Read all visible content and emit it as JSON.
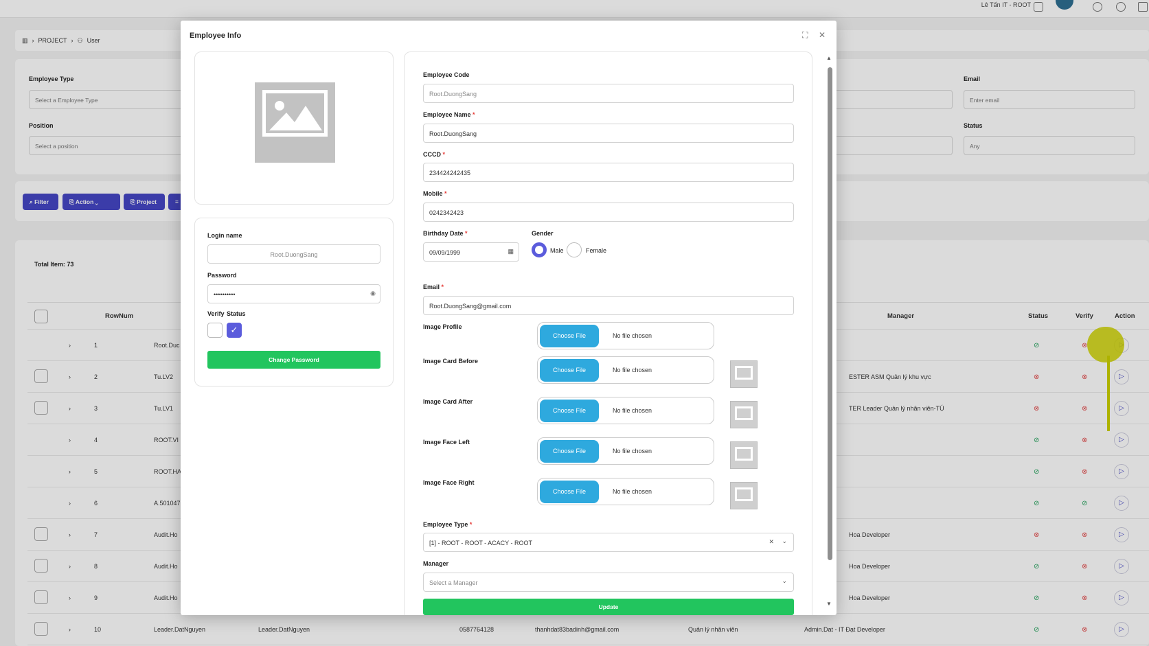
{
  "background": {
    "user_name": "Lê Tấn IT - ROOT",
    "breadcrumb": {
      "project": "PROJECT",
      "user": "User"
    },
    "filters": {
      "employee_type_label": "Employee Type",
      "employee_type_placeholder": "Select a Employee Type",
      "position_label": "Position",
      "position_placeholder": "Select a position",
      "email_label": "Email",
      "email_placeholder": "Enter email",
      "status_label": "Status",
      "status_value": "Any"
    },
    "toolbar": {
      "filter": "Filter",
      "action": "Action",
      "project": "Project"
    },
    "total_items": "Total Item: 73",
    "columns": {
      "rownum": "RowNum",
      "manager": "Manager",
      "status": "Status",
      "verify": "Verify",
      "action": "Action"
    },
    "rows": [
      {
        "num": "1",
        "name": "Root.Duc",
        "manager": "",
        "status": "ok",
        "verify": "no"
      },
      {
        "num": "2",
        "name": "Tu.LV2",
        "manager": "ESTER ASM Quản lý khu vực",
        "status": "no",
        "verify": "no"
      },
      {
        "num": "3",
        "name": "Tu.LV1",
        "manager": "TER Leader Quản lý nhân viên-TÚ",
        "status": "no",
        "verify": "no"
      },
      {
        "num": "4",
        "name": "ROOT.VI",
        "manager": "",
        "status": "ok",
        "verify": "no"
      },
      {
        "num": "5",
        "name": "ROOT.HA",
        "manager": "",
        "status": "ok",
        "verify": "no"
      },
      {
        "num": "6",
        "name": "A.501047",
        "manager": "",
        "status": "ok",
        "verify": "ok"
      },
      {
        "num": "7",
        "name": "Audit.Ho",
        "manager": "Hoa Developer",
        "status": "no",
        "verify": "no"
      },
      {
        "num": "8",
        "name": "Audit.Ho",
        "manager": "Hoa Developer",
        "status": "ok",
        "verify": "no"
      },
      {
        "num": "9",
        "name": "Audit.Ho",
        "manager": "Hoa Developer",
        "status": "ok",
        "verify": "no"
      },
      {
        "num": "10",
        "name": "Leader.DatNguyen",
        "username": "Leader.DatNguyen",
        "phone": "0587764128",
        "email": "thanhdat83badinh@gmail.com",
        "position": "Quản lý nhân viên",
        "manager": "Admin.Dat - IT Đạt Developer",
        "status": "ok",
        "verify": "no"
      }
    ]
  },
  "modal": {
    "title": "Employee Info",
    "login": {
      "login_name_label": "Login name",
      "login_name_value": "Root.DuongSang",
      "password_label": "Password",
      "password_value": "••••••••••",
      "verify_label": "Verify",
      "status_label": "Status",
      "change_password": "Change Password"
    },
    "form": {
      "employee_code_label": "Employee Code",
      "employee_code_value": "Root.DuongSang",
      "employee_name_label": "Employee Name",
      "employee_name_value": "Root.DuongSang",
      "cccd_label": "CCCD",
      "cccd_value": "234424242435",
      "mobile_label": "Mobile",
      "mobile_value": "0242342423",
      "birthday_label": "Birthday Date",
      "birthday_value": "09/09/1999",
      "gender_label": "Gender",
      "gender_male": "Male",
      "gender_female": "Female",
      "email_label": "Email",
      "email_value": "Root.DuongSang@gmail.com",
      "choose_file": "Choose File",
      "no_file": "No file chosen",
      "image_profile": "Image Profile",
      "image_card_before": "Image Card Before",
      "image_card_after": "Image Card After",
      "image_face_left": "Image Face Left",
      "image_face_right": "Image Face Right",
      "employee_type_label": "Employee Type",
      "employee_type_value": "[1] - ROOT - ROOT - ACACY - ROOT",
      "manager_label": "Manager",
      "manager_placeholder": "Select a Manager",
      "update": "Update",
      "required_mark": "*"
    }
  }
}
